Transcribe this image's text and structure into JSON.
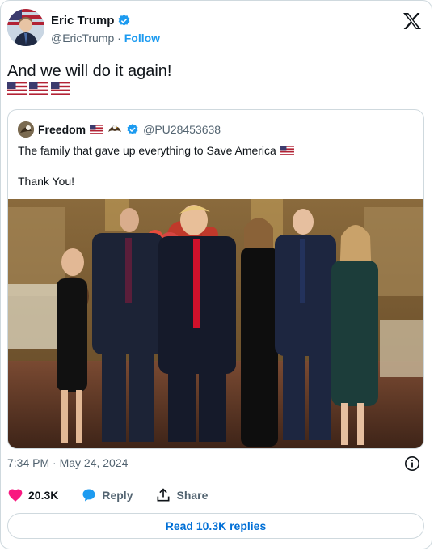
{
  "author": {
    "display_name": "Eric Trump",
    "handle": "@EricTrump",
    "separator": "·",
    "follow_label": "Follow"
  },
  "tweet": {
    "text": "And we will do it again!"
  },
  "quoted": {
    "display_name": "Freedom",
    "handle": "@PU28453638",
    "line1": "The family that gave up everything to Save America",
    "line2": "Thank You!"
  },
  "meta": {
    "timestamp": "7:34 PM · May 24, 2024"
  },
  "actions": {
    "likes": "20.3K",
    "reply_label": "Reply",
    "share_label": "Share"
  },
  "read_replies_label": "Read 10.3K replies",
  "colors": {
    "accent": "#1d9bf0",
    "like": "#f91880",
    "link": "#006fd6",
    "muted": "#536471"
  },
  "icons": [
    "verified-badge-icon",
    "x-logo-icon",
    "us-flag-icon",
    "heart-icon",
    "reply-bubble-icon",
    "share-icon",
    "info-icon",
    "eagle-icon"
  ]
}
